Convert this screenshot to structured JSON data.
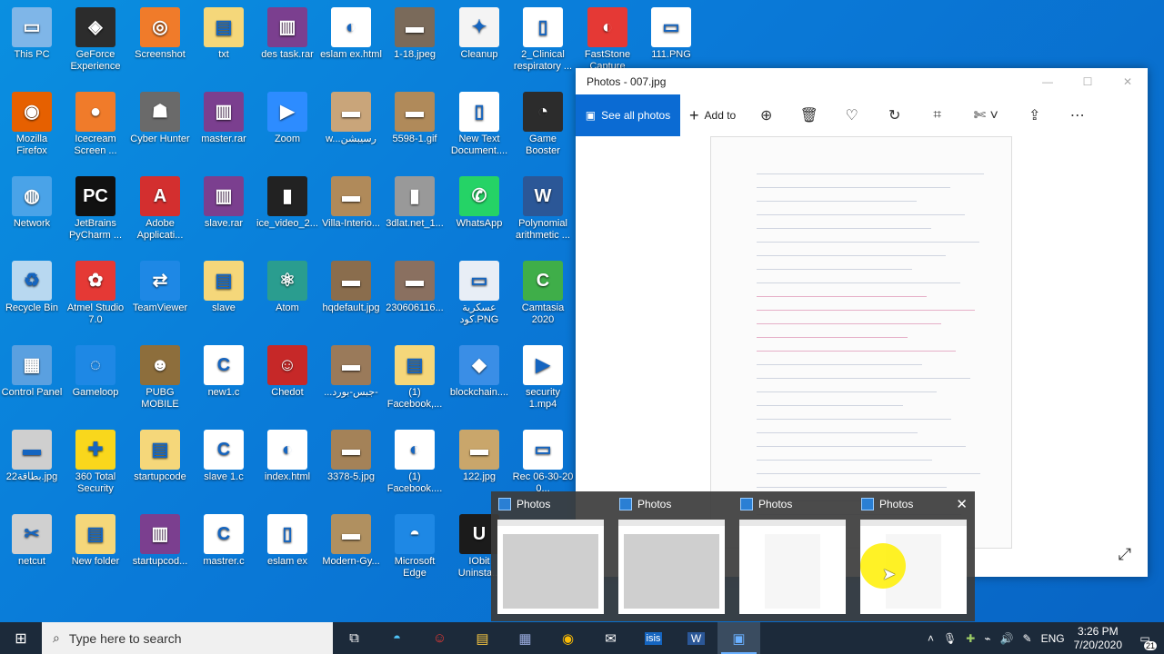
{
  "desktop": {
    "icons": [
      {
        "label": "This PC",
        "color": "#7fb6e8",
        "glyph": "▭",
        "col": 0,
        "row": 0
      },
      {
        "label": "Mozilla Firefox",
        "color": "#e66000",
        "glyph": "◉",
        "col": 0,
        "row": 1
      },
      {
        "label": "Network",
        "color": "#4aa3e8",
        "glyph": "◍",
        "col": 0,
        "row": 2
      },
      {
        "label": "Recycle Bin",
        "color": "#b8d8f0",
        "glyph": "♻",
        "col": 0,
        "row": 3
      },
      {
        "label": "Control Panel",
        "color": "#5aa0e0",
        "glyph": "▦",
        "col": 0,
        "row": 4
      },
      {
        "label": "بطاقة22.jpg",
        "color": "#cfcfcf",
        "glyph": "▬",
        "col": 0,
        "row": 5
      },
      {
        "label": "netcut",
        "color": "#d0d0d0",
        "glyph": "✂",
        "col": 0,
        "row": 6
      },
      {
        "label": "GeForce Experience",
        "color": "#2c2c2c",
        "glyph": "◈",
        "col": 1,
        "row": 0
      },
      {
        "label": "Icecream Screen ...",
        "color": "#f07b2a",
        "glyph": "●",
        "col": 1,
        "row": 1
      },
      {
        "label": "JetBrains PyCharm ...",
        "color": "#111111",
        "glyph": "PC",
        "col": 1,
        "row": 2
      },
      {
        "label": "Atmel Studio 7.0",
        "color": "#e53935",
        "glyph": "✿",
        "col": 1,
        "row": 3
      },
      {
        "label": "Gameloop",
        "color": "#1e88e5",
        "glyph": "◌",
        "col": 1,
        "row": 4
      },
      {
        "label": "360 Total Security",
        "color": "#f9d71c",
        "glyph": "✚",
        "col": 1,
        "row": 5
      },
      {
        "label": "New folder",
        "color": "#f5d77a",
        "glyph": "▤",
        "col": 1,
        "row": 6
      },
      {
        "label": "Screenshot",
        "color": "#f07b2a",
        "glyph": "◎",
        "col": 2,
        "row": 0
      },
      {
        "label": "Cyber Hunter",
        "color": "#6a6a6a",
        "glyph": "☗",
        "col": 2,
        "row": 1
      },
      {
        "label": "Adobe Applicati...",
        "color": "#d32f2f",
        "glyph": "A",
        "col": 2,
        "row": 2
      },
      {
        "label": "TeamViewer",
        "color": "#1e88e5",
        "glyph": "⇄",
        "col": 2,
        "row": 3
      },
      {
        "label": "PUBG MOBILE",
        "color": "#8d6e3c",
        "glyph": "☻",
        "col": 2,
        "row": 4
      },
      {
        "label": "startupcode",
        "color": "#f5d77a",
        "glyph": "▤",
        "col": 2,
        "row": 5
      },
      {
        "label": "startupcod...",
        "color": "#7b3f8f",
        "glyph": "▥",
        "col": 2,
        "row": 6
      },
      {
        "label": "txt",
        "color": "#f5d77a",
        "glyph": "▤",
        "col": 3,
        "row": 0
      },
      {
        "label": "master.rar",
        "color": "#7b3f8f",
        "glyph": "▥",
        "col": 3,
        "row": 1
      },
      {
        "label": "slave.rar",
        "color": "#7b3f8f",
        "glyph": "▥",
        "col": 3,
        "row": 2
      },
      {
        "label": "slave",
        "color": "#f5d77a",
        "glyph": "▤",
        "col": 3,
        "row": 3
      },
      {
        "label": "new1.c",
        "color": "#ffffff",
        "glyph": "C",
        "col": 3,
        "row": 4
      },
      {
        "label": "slave 1.c",
        "color": "#ffffff",
        "glyph": "C",
        "col": 3,
        "row": 5
      },
      {
        "label": "mastrer.c",
        "color": "#ffffff",
        "glyph": "C",
        "col": 3,
        "row": 6
      },
      {
        "label": "des task.rar",
        "color": "#7b3f8f",
        "glyph": "▥",
        "col": 4,
        "row": 0
      },
      {
        "label": "Zoom",
        "color": "#2d8cff",
        "glyph": "▶",
        "col": 4,
        "row": 1
      },
      {
        "label": "ice_video_2...",
        "color": "#222222",
        "glyph": "▮",
        "col": 4,
        "row": 2
      },
      {
        "label": "Atom",
        "color": "#2a9d8f",
        "glyph": "⚛",
        "col": 4,
        "row": 3
      },
      {
        "label": "Chedot",
        "color": "#c62828",
        "glyph": "☺",
        "col": 4,
        "row": 4
      },
      {
        "label": "index.html",
        "color": "#ffffff",
        "glyph": "◐",
        "col": 4,
        "row": 5
      },
      {
        "label": "eslam ex",
        "color": "#ffffff",
        "glyph": "▯",
        "col": 4,
        "row": 6
      },
      {
        "label": "eslam ex.html",
        "color": "#ffffff",
        "glyph": "◐",
        "col": 5,
        "row": 0
      },
      {
        "label": "w...رسيبشن",
        "color": "#c9a57a",
        "glyph": "▬",
        "col": 5,
        "row": 1
      },
      {
        "label": "Villa-Interio...",
        "color": "#b08a5a",
        "glyph": "▬",
        "col": 5,
        "row": 2
      },
      {
        "label": "hqdefault.jpg",
        "color": "#8a6d4d",
        "glyph": "▬",
        "col": 5,
        "row": 3
      },
      {
        "label": "...جبس-بورد-",
        "color": "#9a7a5a",
        "glyph": "▬",
        "col": 5,
        "row": 4
      },
      {
        "label": "3378-5.jpg",
        "color": "#a48258",
        "glyph": "▬",
        "col": 5,
        "row": 5
      },
      {
        "label": "Modern-Gy...",
        "color": "#b09060",
        "glyph": "▬",
        "col": 5,
        "row": 6
      },
      {
        "label": "1-18.jpeg",
        "color": "#7a6a5a",
        "glyph": "▬",
        "col": 6,
        "row": 0
      },
      {
        "label": "5598-1.gif",
        "color": "#b08a5a",
        "glyph": "▬",
        "col": 6,
        "row": 1
      },
      {
        "label": "3dlat.net_1...",
        "color": "#999999",
        "glyph": "▮",
        "col": 6,
        "row": 2
      },
      {
        "label": "230606116...",
        "color": "#8a7060",
        "glyph": "▬",
        "col": 6,
        "row": 3
      },
      {
        "label": "(1) Facebook,...",
        "color": "#f5d77a",
        "glyph": "▤",
        "col": 6,
        "row": 4
      },
      {
        "label": "(1) Facebook....",
        "color": "#ffffff",
        "glyph": "◐",
        "col": 6,
        "row": 5
      },
      {
        "label": "Microsoft Edge",
        "color": "#1e88e5",
        "glyph": "◓",
        "col": 6,
        "row": 6
      },
      {
        "label": "Cleanup",
        "color": "#f4f4f4",
        "glyph": "✦",
        "col": 7,
        "row": 0
      },
      {
        "label": "New Text Document....",
        "color": "#ffffff",
        "glyph": "▯",
        "col": 7,
        "row": 1
      },
      {
        "label": "WhatsApp",
        "color": "#25d366",
        "glyph": "✆",
        "col": 7,
        "row": 2
      },
      {
        "label": "عسكرية كود.PNG",
        "color": "#e8eef6",
        "glyph": "▭",
        "col": 7,
        "row": 3
      },
      {
        "label": "blockchain....",
        "color": "#3a8ee6",
        "glyph": "◆",
        "col": 7,
        "row": 4
      },
      {
        "label": "122.jpg",
        "color": "#c9a66b",
        "glyph": "▬",
        "col": 7,
        "row": 5
      },
      {
        "label": "IObit Uninsta...",
        "color": "#1b1b1b",
        "glyph": "U",
        "col": 7,
        "row": 6
      },
      {
        "label": "2_Clinical respiratory ...",
        "color": "#ffffff",
        "glyph": "▯",
        "col": 8,
        "row": 0
      },
      {
        "label": "Game Booster",
        "color": "#2c2c2c",
        "glyph": "◔",
        "col": 8,
        "row": 1
      },
      {
        "label": "Polynomial arithmetic ...",
        "color": "#2b5797",
        "glyph": "W",
        "col": 8,
        "row": 2
      },
      {
        "label": "Camtasia 2020",
        "color": "#3fae49",
        "glyph": "C",
        "col": 8,
        "row": 3
      },
      {
        "label": "security 1.mp4",
        "color": "#ffffff",
        "glyph": "▶",
        "col": 8,
        "row": 4
      },
      {
        "label": "Rec 06-30-20 0...",
        "color": "#ffffff",
        "glyph": "▭",
        "col": 8,
        "row": 5
      },
      {
        "label": "FastStone Capture",
        "color": "#e53935",
        "glyph": "◐",
        "col": 9,
        "row": 0
      },
      {
        "label": "111.PNG",
        "color": "#ffffff",
        "glyph": "▭",
        "col": 10,
        "row": 0
      }
    ]
  },
  "photos_window": {
    "title": "Photos - 007.jpg",
    "see_all": "See all photos",
    "add_to": "Add to"
  },
  "thumbnails": [
    {
      "title": "Photos"
    },
    {
      "title": "Photos"
    },
    {
      "title": "Photos"
    },
    {
      "title": "Photos"
    }
  ],
  "taskbar": {
    "search_placeholder": "Type here to search",
    "language": "ENG",
    "time": "3:26 PM",
    "date": "7/20/2020",
    "notification_count": "21"
  },
  "colors": {
    "accent": "#0b6bd3",
    "taskbar": "#1c2a3a"
  }
}
